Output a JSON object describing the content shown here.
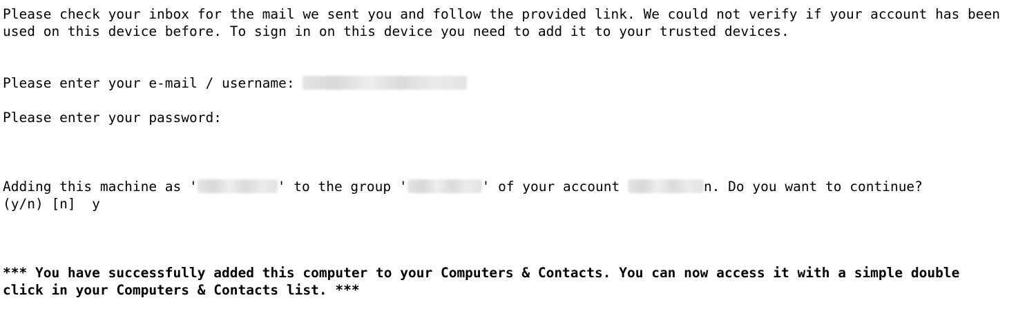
{
  "console": {
    "intro": {
      "line1": "Please check your inbox for the mail we sent you and follow the provided link. We could not verify if your account has been",
      "line2": "used on this device before. To sign in on this device you need to add it to your trusted devices."
    },
    "email_prompt": "Please enter your e-mail / username: ",
    "password_prompt": "Please enter your password:",
    "add_machine": {
      "part1": "Adding this machine as '",
      "part2": "' to the group '",
      "part3": "' of your account ",
      "part4": "n. Do you want to continue?",
      "line2": "(y/n) [n]  y"
    },
    "success": {
      "line1": "*** You have successfully added this computer to your Computers & Contacts. You can now access it with a simple double",
      "line2": "click in your Computers & Contacts list. ***"
    }
  }
}
